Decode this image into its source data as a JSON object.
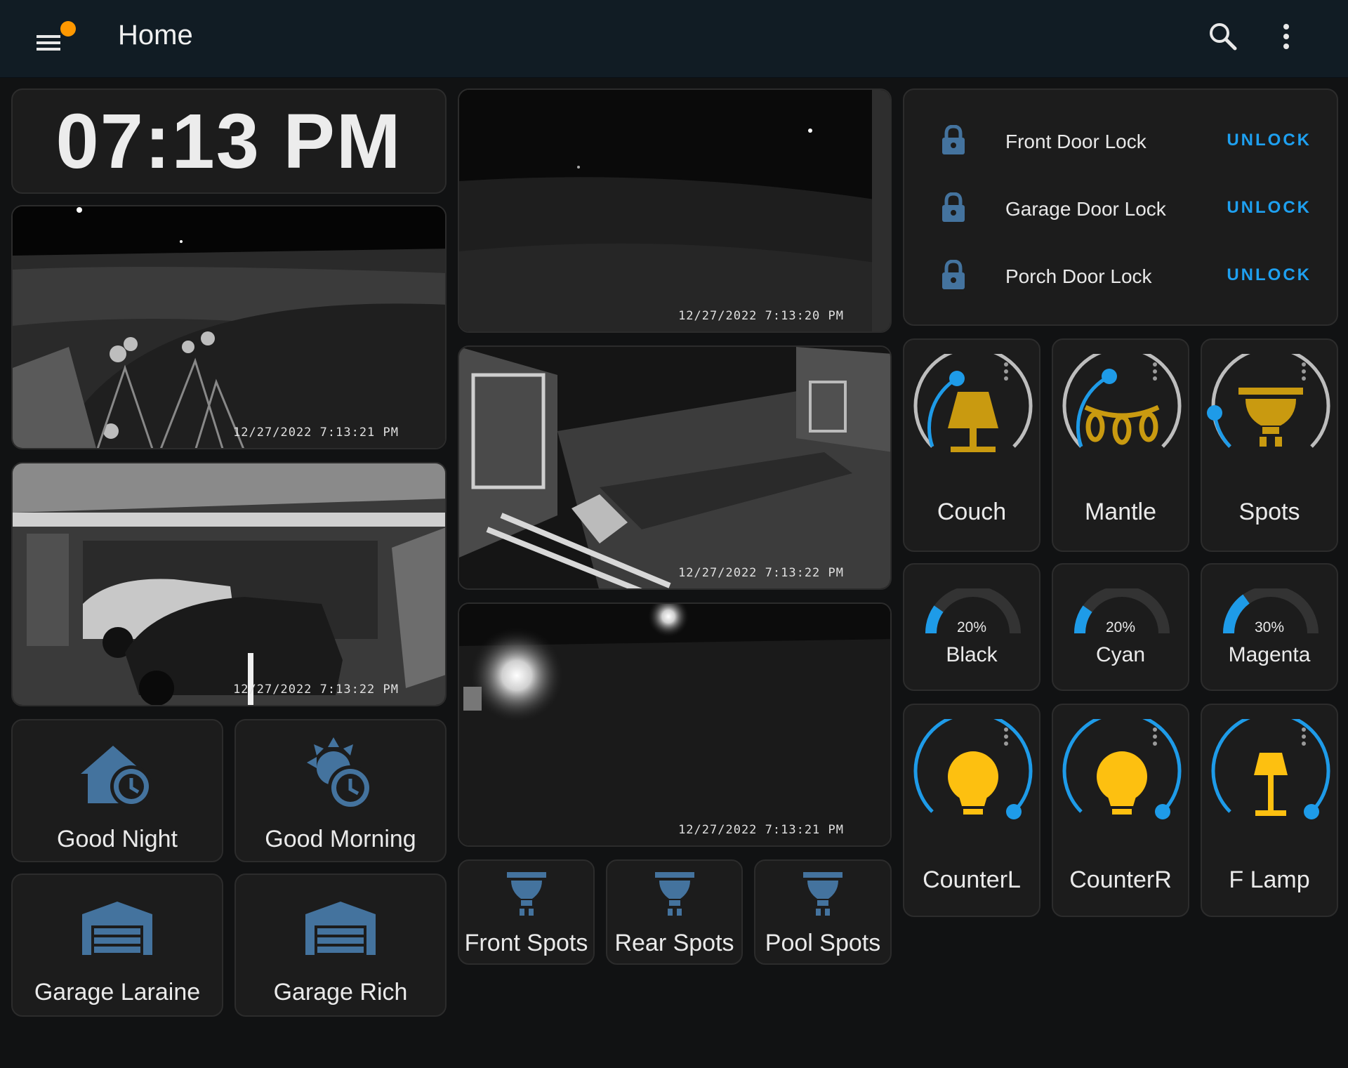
{
  "header": {
    "title": "Home"
  },
  "clock": {
    "time": "07:13 PM"
  },
  "cameras": [
    {
      "name": "front-yard",
      "timestamp": "12/27/2022 7:13:21 PM"
    },
    {
      "name": "garage",
      "timestamp": "12/27/2022 7:13:22 PM"
    },
    {
      "name": "side-yard",
      "timestamp": "12/27/2022 7:13:20 PM"
    },
    {
      "name": "back-deck",
      "timestamp": "12/27/2022 7:13:22 PM"
    },
    {
      "name": "backyard",
      "timestamp": "12/27/2022 7:13:21 PM"
    }
  ],
  "scenes": [
    {
      "label": "Good Night",
      "icon": "home-clock-icon"
    },
    {
      "label": "Good Morning",
      "icon": "weather-clock-icon"
    },
    {
      "label": "Garage Laraine",
      "icon": "garage-icon"
    },
    {
      "label": "Garage Rich",
      "icon": "garage-icon"
    }
  ],
  "spots": [
    {
      "label": "Front Spots",
      "icon": "ceiling-spot-icon"
    },
    {
      "label": "Rear Spots",
      "icon": "ceiling-spot-icon"
    },
    {
      "label": "Pool Spots",
      "icon": "ceiling-spot-icon"
    }
  ],
  "locks": [
    {
      "name": "Front Door Lock",
      "action": "UNLOCK"
    },
    {
      "name": "Garage Door Lock",
      "action": "UNLOCK"
    },
    {
      "name": "Porch Door Lock",
      "action": "UNLOCK"
    }
  ],
  "lights_row1": [
    {
      "label": "Couch",
      "icon": "table-lamp-icon",
      "level": 0.25
    },
    {
      "label": "Mantle",
      "icon": "string-lights-icon",
      "level": 0.5
    },
    {
      "label": "Spots",
      "icon": "ceiling-spot-icon",
      "level": 0.02
    }
  ],
  "gauges": [
    {
      "label": "Black",
      "percent": "20%",
      "value": 0.2
    },
    {
      "label": "Cyan",
      "percent": "20%",
      "value": 0.2
    },
    {
      "label": "Magenta",
      "percent": "30%",
      "value": 0.3
    }
  ],
  "lights_row2": [
    {
      "label": "CounterL",
      "icon": "lightbulb-icon",
      "level": 1.0
    },
    {
      "label": "CounterR",
      "icon": "lightbulb-icon",
      "level": 1.0
    },
    {
      "label": "F Lamp",
      "icon": "floor-lamp-icon",
      "level": 1.0
    }
  ],
  "colors": {
    "accent": "#1ea0f0",
    "icon_blue": "#44739e",
    "light_on": "#fdc010",
    "light_dim": "#c99a10",
    "notification": "#ff9800",
    "header_bg": "#111c24",
    "card_bg": "#1c1c1c"
  }
}
